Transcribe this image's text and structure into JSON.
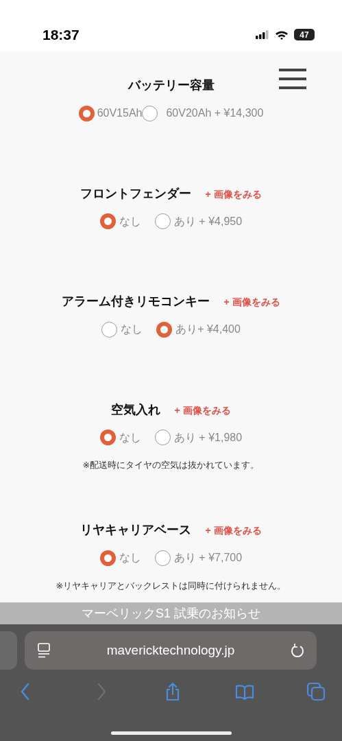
{
  "status_bar": {
    "time": "18:37",
    "battery": "47"
  },
  "sections": [
    {
      "title": "バッテリー容量",
      "options": [
        {
          "label": "60V15Ah",
          "selected": true
        },
        {
          "label": "60V20Ah + ¥14,300",
          "selected": false
        }
      ],
      "tight": true
    },
    {
      "title": "フロントフェンダー",
      "image_link": "+ 画像をみる",
      "options": [
        {
          "label": "なし",
          "selected": true
        },
        {
          "label": "あり + ¥4,950",
          "selected": false
        }
      ]
    },
    {
      "title": "アラーム付きリモコンキー",
      "image_link": "+ 画像をみる",
      "options": [
        {
          "label": "なし",
          "selected": false
        },
        {
          "label": "あり+ ¥4,400",
          "selected": true
        }
      ]
    },
    {
      "title": "空気入れ",
      "image_link": "+ 画像をみる",
      "options": [
        {
          "label": "なし",
          "selected": true
        },
        {
          "label": "あり + ¥1,980",
          "selected": false
        }
      ],
      "note": "※配送時にタイヤの空気は抜かれています。"
    },
    {
      "title": "リヤキャリアベース",
      "image_link": "+ 画像をみる",
      "options": [
        {
          "label": "なし",
          "selected": true
        },
        {
          "label": "あり + ¥7,700",
          "selected": false
        }
      ],
      "note": "※リヤキャリアとバックレストは同時に付けられません。"
    }
  ],
  "notice_bar": {
    "text": "マーベリックS1 試乗のお知らせ"
  },
  "browser": {
    "url": "mavericktechnology.jp",
    "toolbar": [
      {
        "kind": "back",
        "disabled": false
      },
      {
        "kind": "forward",
        "disabled": true
      },
      {
        "kind": "share",
        "disabled": false
      },
      {
        "kind": "bookmarks",
        "disabled": false
      },
      {
        "kind": "tabs",
        "disabled": false
      }
    ]
  }
}
